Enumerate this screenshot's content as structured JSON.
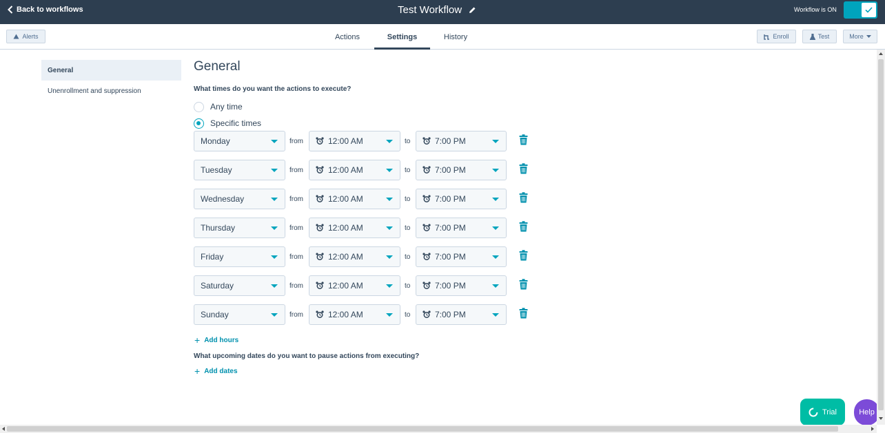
{
  "topbar": {
    "back_label": "Back to workflows",
    "title": "Test Workflow",
    "status_label": "Workflow is ON",
    "toggle_on": true
  },
  "subnav": {
    "alerts_label": "Alerts",
    "tabs": [
      {
        "label": "Actions",
        "active": false
      },
      {
        "label": "Settings",
        "active": true
      },
      {
        "label": "History",
        "active": false
      }
    ],
    "enroll_label": "Enroll",
    "test_label": "Test",
    "more_label": "More"
  },
  "sidebar": {
    "items": [
      {
        "label": "General",
        "active": true
      },
      {
        "label": "Unenrollment and suppression",
        "active": false
      }
    ]
  },
  "main": {
    "heading": "General",
    "question_times": "What times do you want the actions to execute?",
    "radio_any": "Any time",
    "radio_specific": "Specific times",
    "selected_option": "Specific times",
    "from_label": "from",
    "to_label": "to",
    "schedule": [
      {
        "day": "Monday",
        "from": "12:00 AM",
        "to": "7:00 PM"
      },
      {
        "day": "Tuesday",
        "from": "12:00 AM",
        "to": "7:00 PM"
      },
      {
        "day": "Wednesday",
        "from": "12:00 AM",
        "to": "7:00 PM"
      },
      {
        "day": "Thursday",
        "from": "12:00 AM",
        "to": "7:00 PM"
      },
      {
        "day": "Friday",
        "from": "12:00 AM",
        "to": "7:00 PM"
      },
      {
        "day": "Saturday",
        "from": "12:00 AM",
        "to": "7:00 PM"
      },
      {
        "day": "Sunday",
        "from": "12:00 AM",
        "to": "7:00 PM"
      }
    ],
    "add_hours_label": "Add hours",
    "question_dates": "What upcoming dates do you want to pause actions from executing?",
    "add_dates_label": "Add dates"
  },
  "floating": {
    "trial_label": "Trial",
    "help_label": "Help"
  },
  "colors": {
    "topbar_bg": "#2d3e50",
    "accent": "#00a4bd",
    "link": "#0091ae",
    "trial_bg": "#00bda5",
    "help_bg": "#7c4bd8"
  }
}
